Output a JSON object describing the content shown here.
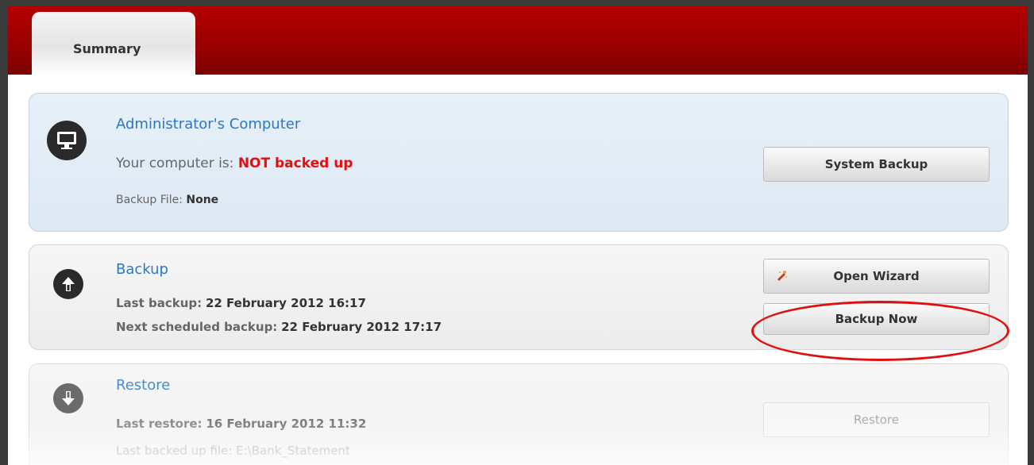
{
  "tabs": [
    {
      "label": "Summary",
      "selected": true
    }
  ],
  "computer": {
    "title": "Administrator's Computer",
    "status_prefix": "Your computer is:",
    "status_value": "NOT backed up",
    "backup_file_label": "Backup File:",
    "backup_file_value": "None",
    "icon": "monitor-icon",
    "button_label": "System Backup"
  },
  "backup": {
    "title": "Backup",
    "icon": "upload-arrow-icon",
    "last_label": "Last backup:",
    "last_value": "22 February 2012 16:17",
    "next_label": "Next scheduled backup:",
    "next_value": "22 February 2012 17:17",
    "wizard_button_label": "Open Wizard",
    "wizard_icon": "wizard-icon",
    "backup_now_label": "Backup Now"
  },
  "restore": {
    "title": "Restore",
    "icon": "download-arrow-icon",
    "last_label": "Last restore:",
    "last_value": "16 February 2012 11:32",
    "file_label": "Last backed up file:",
    "file_value": "E:\\Bank_Statement",
    "button_label": "Restore"
  },
  "colors": {
    "header": "#9c0000",
    "title_blue": "#2a78c2",
    "alert_red": "#e01010"
  }
}
